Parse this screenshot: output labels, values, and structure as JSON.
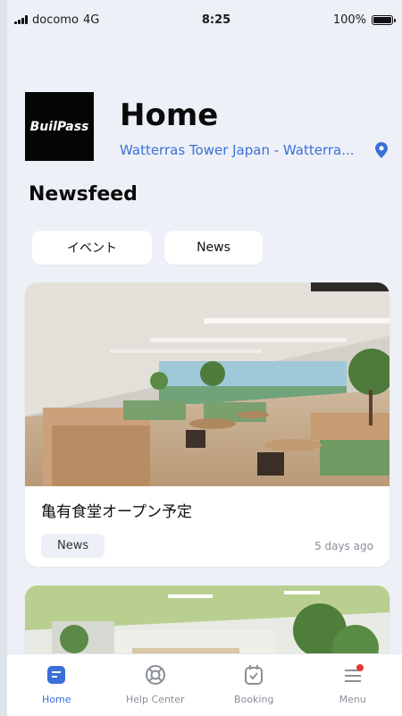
{
  "status": {
    "carrier": "docomo",
    "network": "4G",
    "time": "8:25",
    "battery": "100%"
  },
  "header": {
    "logo_text": "BuilPass",
    "title": "Home",
    "location": "Watterras Tower Japan - Watterra...",
    "icon": "location-pin-icon"
  },
  "newsfeed": {
    "title": "Newsfeed",
    "filters": [
      {
        "label": "イベント"
      },
      {
        "label": "News"
      }
    ],
    "cards": [
      {
        "title": "亀有食堂オープン予定",
        "tag": "News",
        "time": "5 days ago",
        "image": "cafeteria-interior-photo"
      },
      {
        "image": "cafeteria-interior-photo-2"
      }
    ]
  },
  "tabbar": {
    "items": [
      {
        "label": "Home",
        "icon": "home-icon",
        "active": true
      },
      {
        "label": "Help Center",
        "icon": "lifebuoy-icon"
      },
      {
        "label": "Booking",
        "icon": "calendar-check-icon"
      },
      {
        "label": "Menu",
        "icon": "menu-icon",
        "has_badge": true
      }
    ]
  },
  "colors": {
    "accent": "#3a6fd8",
    "background": "#edf1f7",
    "badge": "#e53935"
  }
}
